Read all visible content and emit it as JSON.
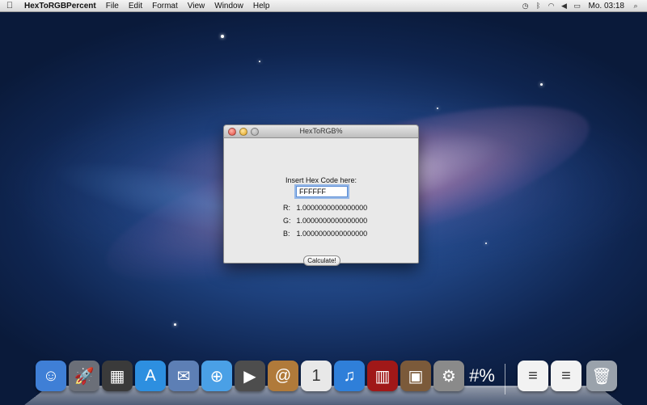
{
  "menubar": {
    "apple": "",
    "app_name": "HexToRGBPercent",
    "items": [
      "File",
      "Edit",
      "Format",
      "View",
      "Window",
      "Help"
    ],
    "status_icons": [
      "time-machine-icon",
      "bluetooth-icon",
      "wifi-icon",
      "volume-icon",
      "battery-icon"
    ],
    "clock": "Mo. 03:18"
  },
  "window": {
    "title": "HexToRGB%",
    "prompt": "Insert Hex Code here:",
    "hex_value": "FFFFFF",
    "results": [
      {
        "label": "R:",
        "value": "1.0000000000000000"
      },
      {
        "label": "G:",
        "value": "1.0000000000000000"
      },
      {
        "label": "B:",
        "value": "1.0000000000000000"
      }
    ],
    "calculate_label": "Calculate!"
  },
  "dock": {
    "apps": [
      {
        "icon": "finder-icon",
        "color": "#3f7fd6",
        "glyph": "☺"
      },
      {
        "icon": "launchpad-icon",
        "color": "#6b6f78",
        "glyph": "🚀"
      },
      {
        "icon": "mission-control-icon",
        "color": "#3a3a3a",
        "glyph": "▦"
      },
      {
        "icon": "app-store-icon",
        "color": "#2d8fe0",
        "glyph": "A"
      },
      {
        "icon": "mail-stamp-icon",
        "color": "#5d7fb5",
        "glyph": "✉"
      },
      {
        "icon": "safari-icon",
        "color": "#4aa0e6",
        "glyph": "⊕"
      },
      {
        "icon": "facetime-icon",
        "color": "#4d4d4d",
        "glyph": "▶"
      },
      {
        "icon": "address-book-icon",
        "color": "#b07a3a",
        "glyph": "@"
      },
      {
        "icon": "ical-icon",
        "color": "#e8e8e8",
        "glyph": "1"
      },
      {
        "icon": "itunes-icon",
        "color": "#2f7fd9",
        "glyph": "♫"
      },
      {
        "icon": "photo-booth-icon",
        "color": "#a01818",
        "glyph": "▥"
      },
      {
        "icon": "iphoto-icon",
        "color": "#7b5a3a",
        "glyph": "▣"
      },
      {
        "icon": "system-preferences-icon",
        "color": "#8a8a8a",
        "glyph": "⚙"
      },
      {
        "icon": "hex-to-rgb-percent-icon",
        "color": "rgba(0,0,0,0)",
        "glyph": "#%"
      },
      {
        "icon": "document-icon",
        "color": "#f2f2f2",
        "glyph": "≡"
      },
      {
        "icon": "document-download-icon",
        "color": "#f2f2f2",
        "glyph": "≡"
      },
      {
        "icon": "trash-icon",
        "color": "#9aa2ab",
        "glyph": "🗑"
      }
    ]
  }
}
